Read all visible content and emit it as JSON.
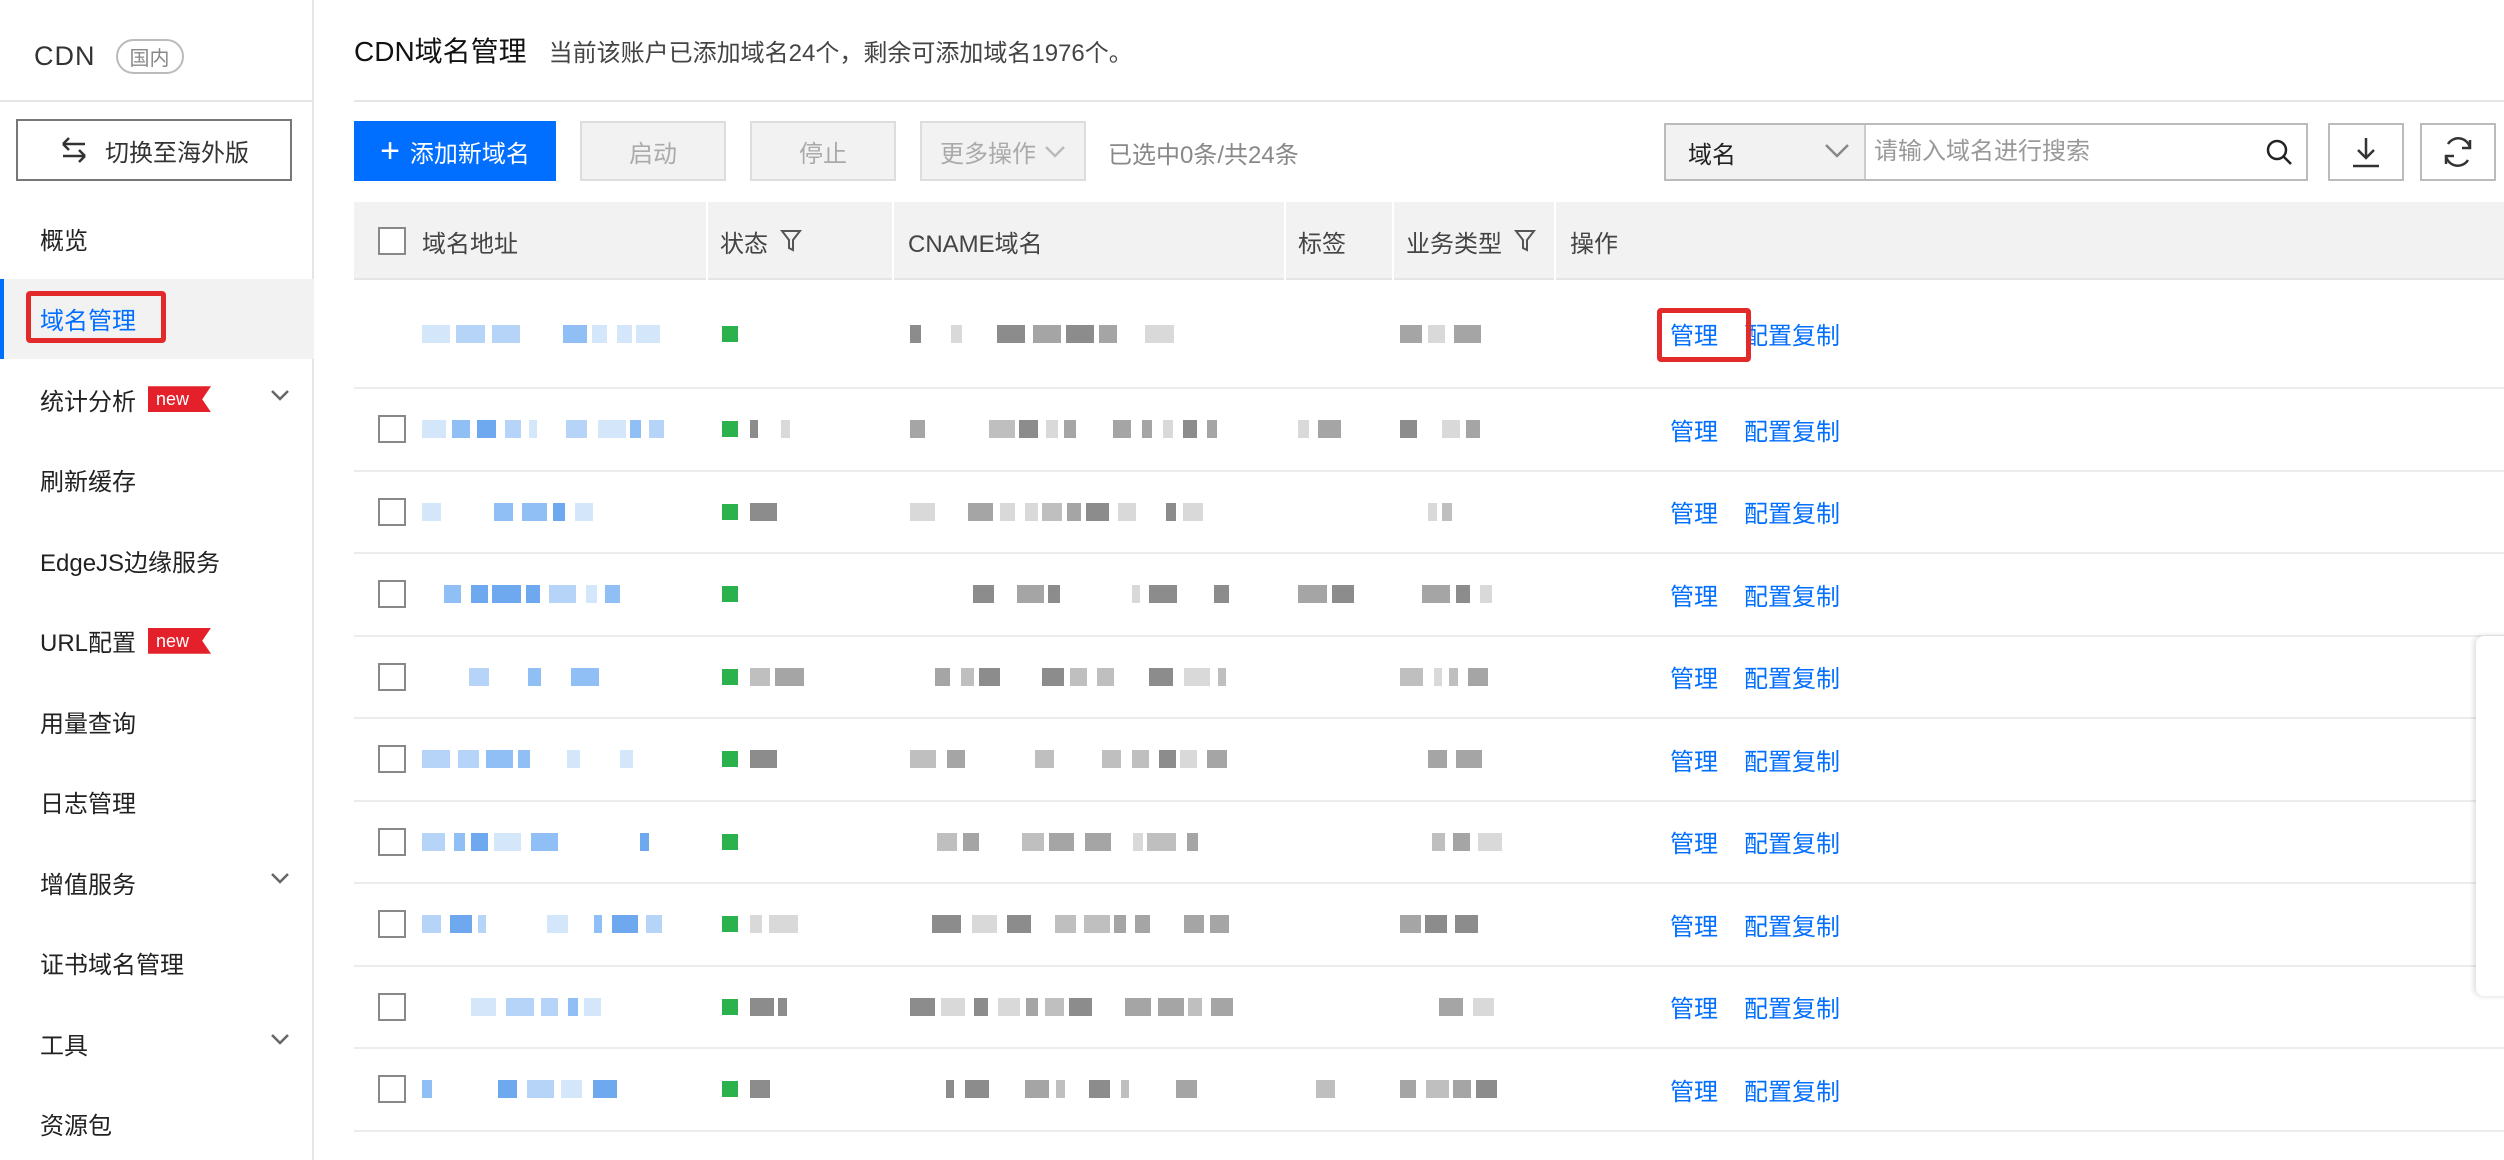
{
  "sidebar": {
    "brand": "CDN",
    "region_badge": "国内",
    "switch_label": "切换至海外版",
    "items": [
      {
        "label": "概览",
        "active": false,
        "badge": "",
        "expandable": false
      },
      {
        "label": "域名管理",
        "active": true,
        "badge": "",
        "expandable": false
      },
      {
        "label": "统计分析",
        "active": false,
        "badge": "new",
        "expandable": true
      },
      {
        "label": "刷新缓存",
        "active": false,
        "badge": "",
        "expandable": false
      },
      {
        "label": "EdgeJS边缘服务",
        "active": false,
        "badge": "",
        "expandable": false
      },
      {
        "label": "URL配置",
        "active": false,
        "badge": "new",
        "expandable": false
      },
      {
        "label": "用量查询",
        "active": false,
        "badge": "",
        "expandable": false
      },
      {
        "label": "日志管理",
        "active": false,
        "badge": "",
        "expandable": false
      },
      {
        "label": "增值服务",
        "active": false,
        "badge": "",
        "expandable": true
      },
      {
        "label": "证书域名管理",
        "active": false,
        "badge": "",
        "expandable": false
      },
      {
        "label": "工具",
        "active": false,
        "badge": "",
        "expandable": true
      },
      {
        "label": "资源包",
        "active": false,
        "badge": "",
        "expandable": false
      }
    ]
  },
  "header": {
    "title": "CDN域名管理",
    "subtitle": "当前该账户已添加域名24个，剩余可添加域名1976个。"
  },
  "toolbar": {
    "add_label": "添加新域名",
    "start_label": "启动",
    "stop_label": "停止",
    "more_label": "更多操作",
    "selection_info": "已选中0条/共24条",
    "search_type": "域名",
    "search_placeholder": "请输入域名进行搜索"
  },
  "table": {
    "columns": {
      "domain": "域名地址",
      "status": "状态",
      "cname": "CNAME域名",
      "tag": "标签",
      "biz_type": "业务类型",
      "actions": "操作"
    },
    "rows": [
      {
        "manage": "管理",
        "copy": "配置复制",
        "status_color": "#2bb24c"
      },
      {
        "manage": "管理",
        "copy": "配置复制",
        "status_color": "#2bb24c"
      },
      {
        "manage": "管理",
        "copy": "配置复制",
        "status_color": "#2bb24c"
      },
      {
        "manage": "管理",
        "copy": "配置复制",
        "status_color": "#2bb24c"
      },
      {
        "manage": "管理",
        "copy": "配置复制",
        "status_color": "#2bb24c"
      },
      {
        "manage": "管理",
        "copy": "配置复制",
        "status_color": "#2bb24c"
      },
      {
        "manage": "管理",
        "copy": "配置复制",
        "status_color": "#2bb24c"
      },
      {
        "manage": "管理",
        "copy": "配置复制",
        "status_color": "#2bb24c"
      },
      {
        "manage": "管理",
        "copy": "配置复制",
        "status_color": "#2bb24c"
      },
      {
        "manage": "管理",
        "copy": "配置复制",
        "status_color": "#2bb24c"
      }
    ]
  },
  "colors": {
    "accent": "#006eff",
    "highlight": "#e32a2a",
    "status_ok": "#2bb24c",
    "new_badge": "#e4212b"
  }
}
